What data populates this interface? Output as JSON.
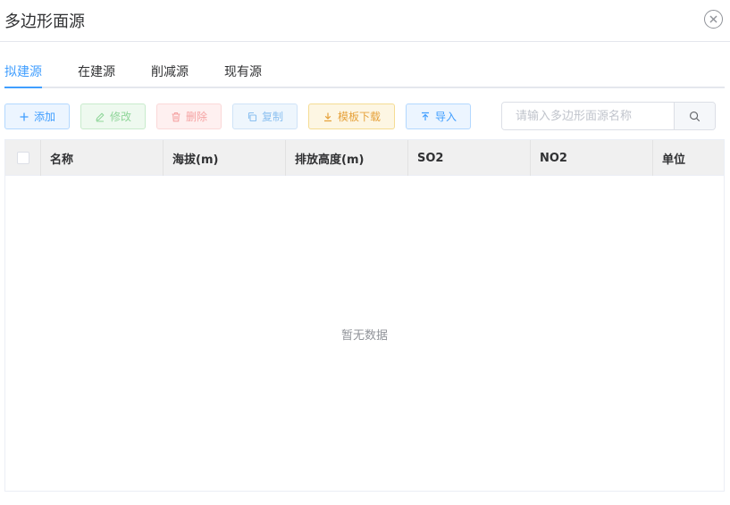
{
  "dialog": {
    "title": "多边形面源"
  },
  "tabs": [
    {
      "label": "拟建源",
      "active": true
    },
    {
      "label": "在建源",
      "active": false
    },
    {
      "label": "削减源",
      "active": false
    },
    {
      "label": "现有源",
      "active": false
    }
  ],
  "toolbar": {
    "add": {
      "label": "添加",
      "icon": "plus-icon"
    },
    "edit": {
      "label": "修改",
      "icon": "edit-icon"
    },
    "delete": {
      "label": "删除",
      "icon": "trash-icon"
    },
    "copy": {
      "label": "复制",
      "icon": "copy-icon"
    },
    "template_download": {
      "label": "模板下载",
      "icon": "download-icon"
    },
    "import": {
      "label": "导入",
      "icon": "upload-icon"
    }
  },
  "search": {
    "placeholder": "请输入多边形面源名称",
    "value": ""
  },
  "table": {
    "columns": [
      "名称",
      "海拔(m)",
      "排放高度(m)",
      "SO2",
      "NO2",
      "单位"
    ],
    "rows": [],
    "empty_text": "暂无数据"
  },
  "colors": {
    "primary": "#409eff",
    "success_light": "#90d69a",
    "danger_light": "#f5a3a3",
    "warning": "#e6a23c",
    "header_bg": "#f0f0f0"
  }
}
